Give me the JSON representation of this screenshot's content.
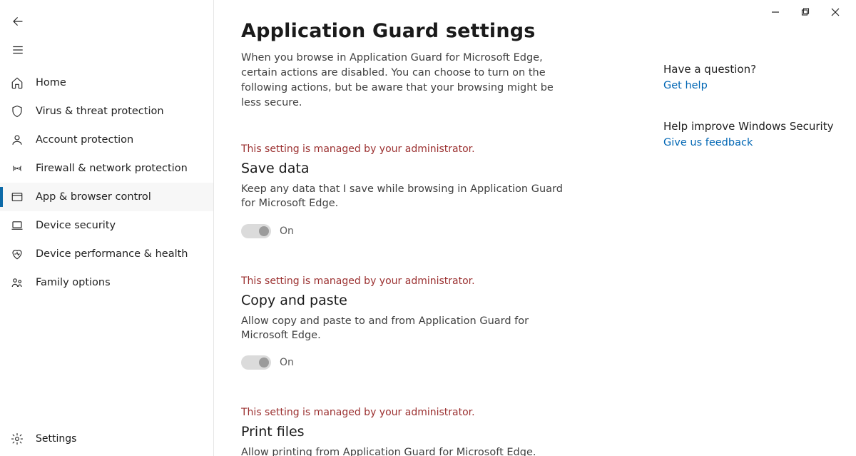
{
  "window": {
    "minimize": "min",
    "restore": "restore",
    "close": "close"
  },
  "sidebar": {
    "items": [
      {
        "label": "Home"
      },
      {
        "label": "Virus & threat protection"
      },
      {
        "label": "Account protection"
      },
      {
        "label": "Firewall & network protection"
      },
      {
        "label": "App & browser control"
      },
      {
        "label": "Device security"
      },
      {
        "label": "Device performance & health"
      },
      {
        "label": "Family options"
      }
    ],
    "settings_label": "Settings"
  },
  "page": {
    "title": "Application Guard settings",
    "intro": "When you browse in Application Guard for Microsoft Edge, certain actions are disabled. You can choose to turn on the following actions, but be aware that your browsing might be less secure."
  },
  "settings": [
    {
      "admin": "This setting is managed by your administrator.",
      "title": "Save data",
      "desc": "Keep any data that I save while browsing in Application Guard for Microsoft Edge.",
      "toggle_label": "On"
    },
    {
      "admin": "This setting is managed by your administrator.",
      "title": "Copy and paste",
      "desc": "Allow copy and paste to and from Application Guard for Microsoft Edge.",
      "toggle_label": "On"
    },
    {
      "admin": "This setting is managed by your administrator.",
      "title": "Print files",
      "desc": "Allow printing from Application Guard for Microsoft Edge."
    }
  ],
  "aside": {
    "question_heading": "Have a question?",
    "help_link": "Get help",
    "improve_heading": "Help improve Windows Security",
    "feedback_link": "Give us feedback"
  }
}
